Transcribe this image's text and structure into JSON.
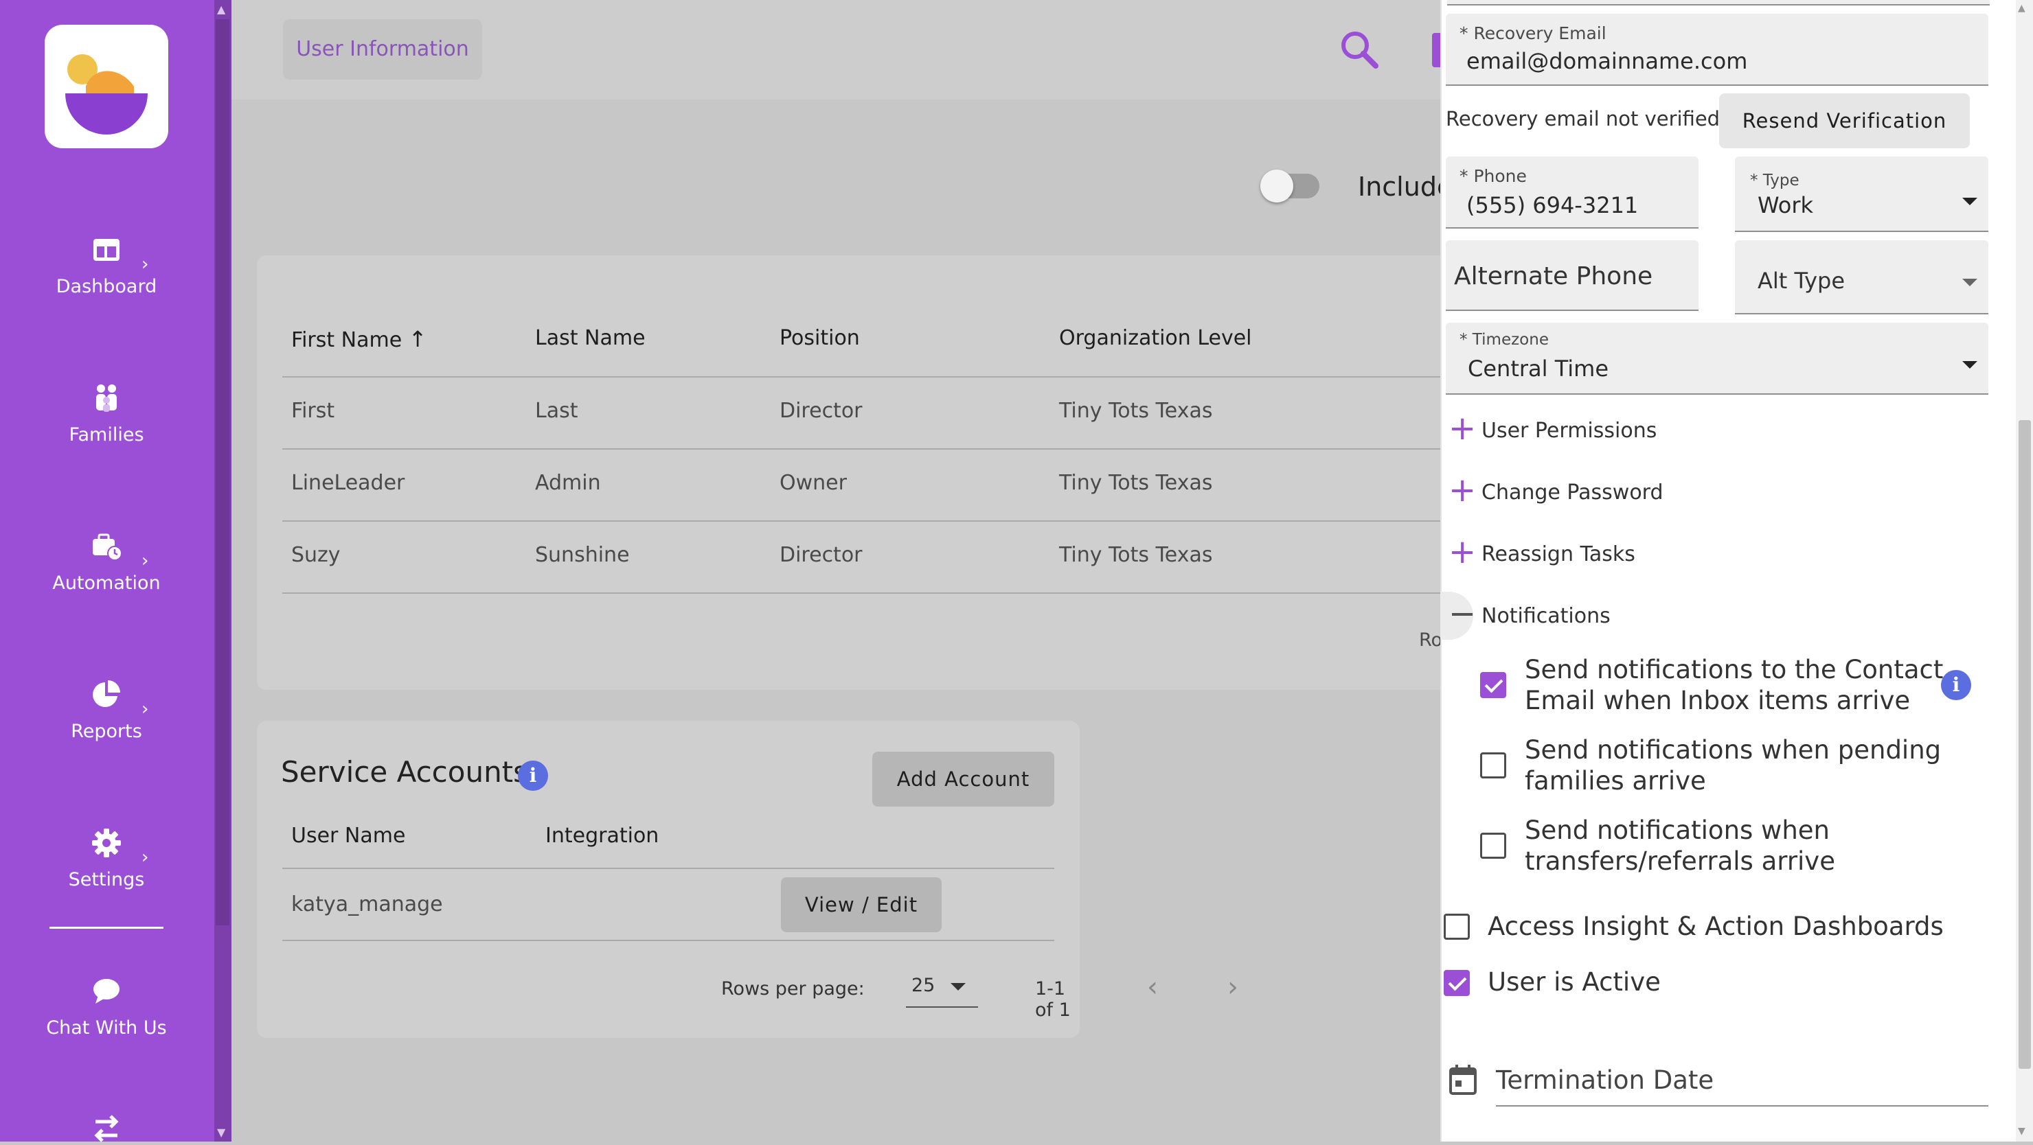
{
  "colors": {
    "brand": "#9b4fd6",
    "info": "#5a6ee0"
  },
  "sidebar": {
    "items": [
      {
        "label": "Dashboard",
        "icon": "dashboard-icon",
        "has_submenu": true
      },
      {
        "label": "Families",
        "icon": "families-icon",
        "has_submenu": false
      },
      {
        "label": "Automation",
        "icon": "briefcase-clock-icon",
        "has_submenu": true
      },
      {
        "label": "Reports",
        "icon": "pie-chart-icon",
        "has_submenu": true
      },
      {
        "label": "Settings",
        "icon": "gear-icon",
        "has_submenu": true
      },
      {
        "label": "Chat With Us",
        "icon": "chat-bubble-icon",
        "has_submenu": false
      }
    ]
  },
  "header": {
    "tab_label": "User Information"
  },
  "toolbar": {
    "include_label": "Include"
  },
  "users_table": {
    "headers": [
      "First Name",
      "Last Name",
      "Position",
      "Organization Level"
    ],
    "rows": [
      [
        "First",
        "Last",
        "Director",
        "Tiny Tots Texas"
      ],
      [
        "LineLeader",
        "Admin",
        "Owner",
        "Tiny Tots Texas"
      ],
      [
        "Suzy",
        "Sunshine",
        "Director",
        "Tiny Tots Texas"
      ]
    ],
    "footer_partial": "Rows"
  },
  "service_accounts": {
    "title": "Service Accounts",
    "add_button": "Add Account",
    "headers": [
      "User Name",
      "Integration"
    ],
    "rows": [
      {
        "user_name": "katya_manage",
        "integration": "",
        "action": "View / Edit"
      }
    ],
    "rows_per_page_label": "Rows per page:",
    "rows_per_page_value": "25",
    "page_range": "1-1 of 1"
  },
  "panel": {
    "recovery_email": {
      "label": "* Recovery Email",
      "value": "email@domainname.com"
    },
    "verification_text": "Recovery email not verified.",
    "resend_button": "Resend Verification",
    "phone": {
      "label": "* Phone",
      "value": "(555) 694-3211"
    },
    "type": {
      "label": "* Type",
      "value": "Work"
    },
    "alt_phone": {
      "placeholder": "Alternate Phone"
    },
    "alt_type": {
      "placeholder": "Alt Type"
    },
    "timezone": {
      "label": "* Timezone",
      "value": "Central Time"
    },
    "sections": [
      {
        "label": "User Permissions",
        "expanded": false
      },
      {
        "label": "Change Password",
        "expanded": false
      },
      {
        "label": "Reassign Tasks",
        "expanded": false
      },
      {
        "label": "Notifications",
        "expanded": true
      }
    ],
    "notifications": [
      {
        "line1": "Send notifications to the Contact",
        "line2": "Email when Inbox items arrive",
        "checked": true
      },
      {
        "line1": "Send notifications when pending",
        "line2": "families arrive",
        "checked": false
      },
      {
        "line1": "Send notifications when",
        "line2": "transfers/referrals arrive",
        "checked": false
      }
    ],
    "access_dashboards": {
      "label": "Access Insight & Action Dashboards",
      "checked": false
    },
    "user_active": {
      "label": "User is Active",
      "checked": true
    },
    "termination_date": {
      "placeholder": "Termination Date"
    }
  }
}
